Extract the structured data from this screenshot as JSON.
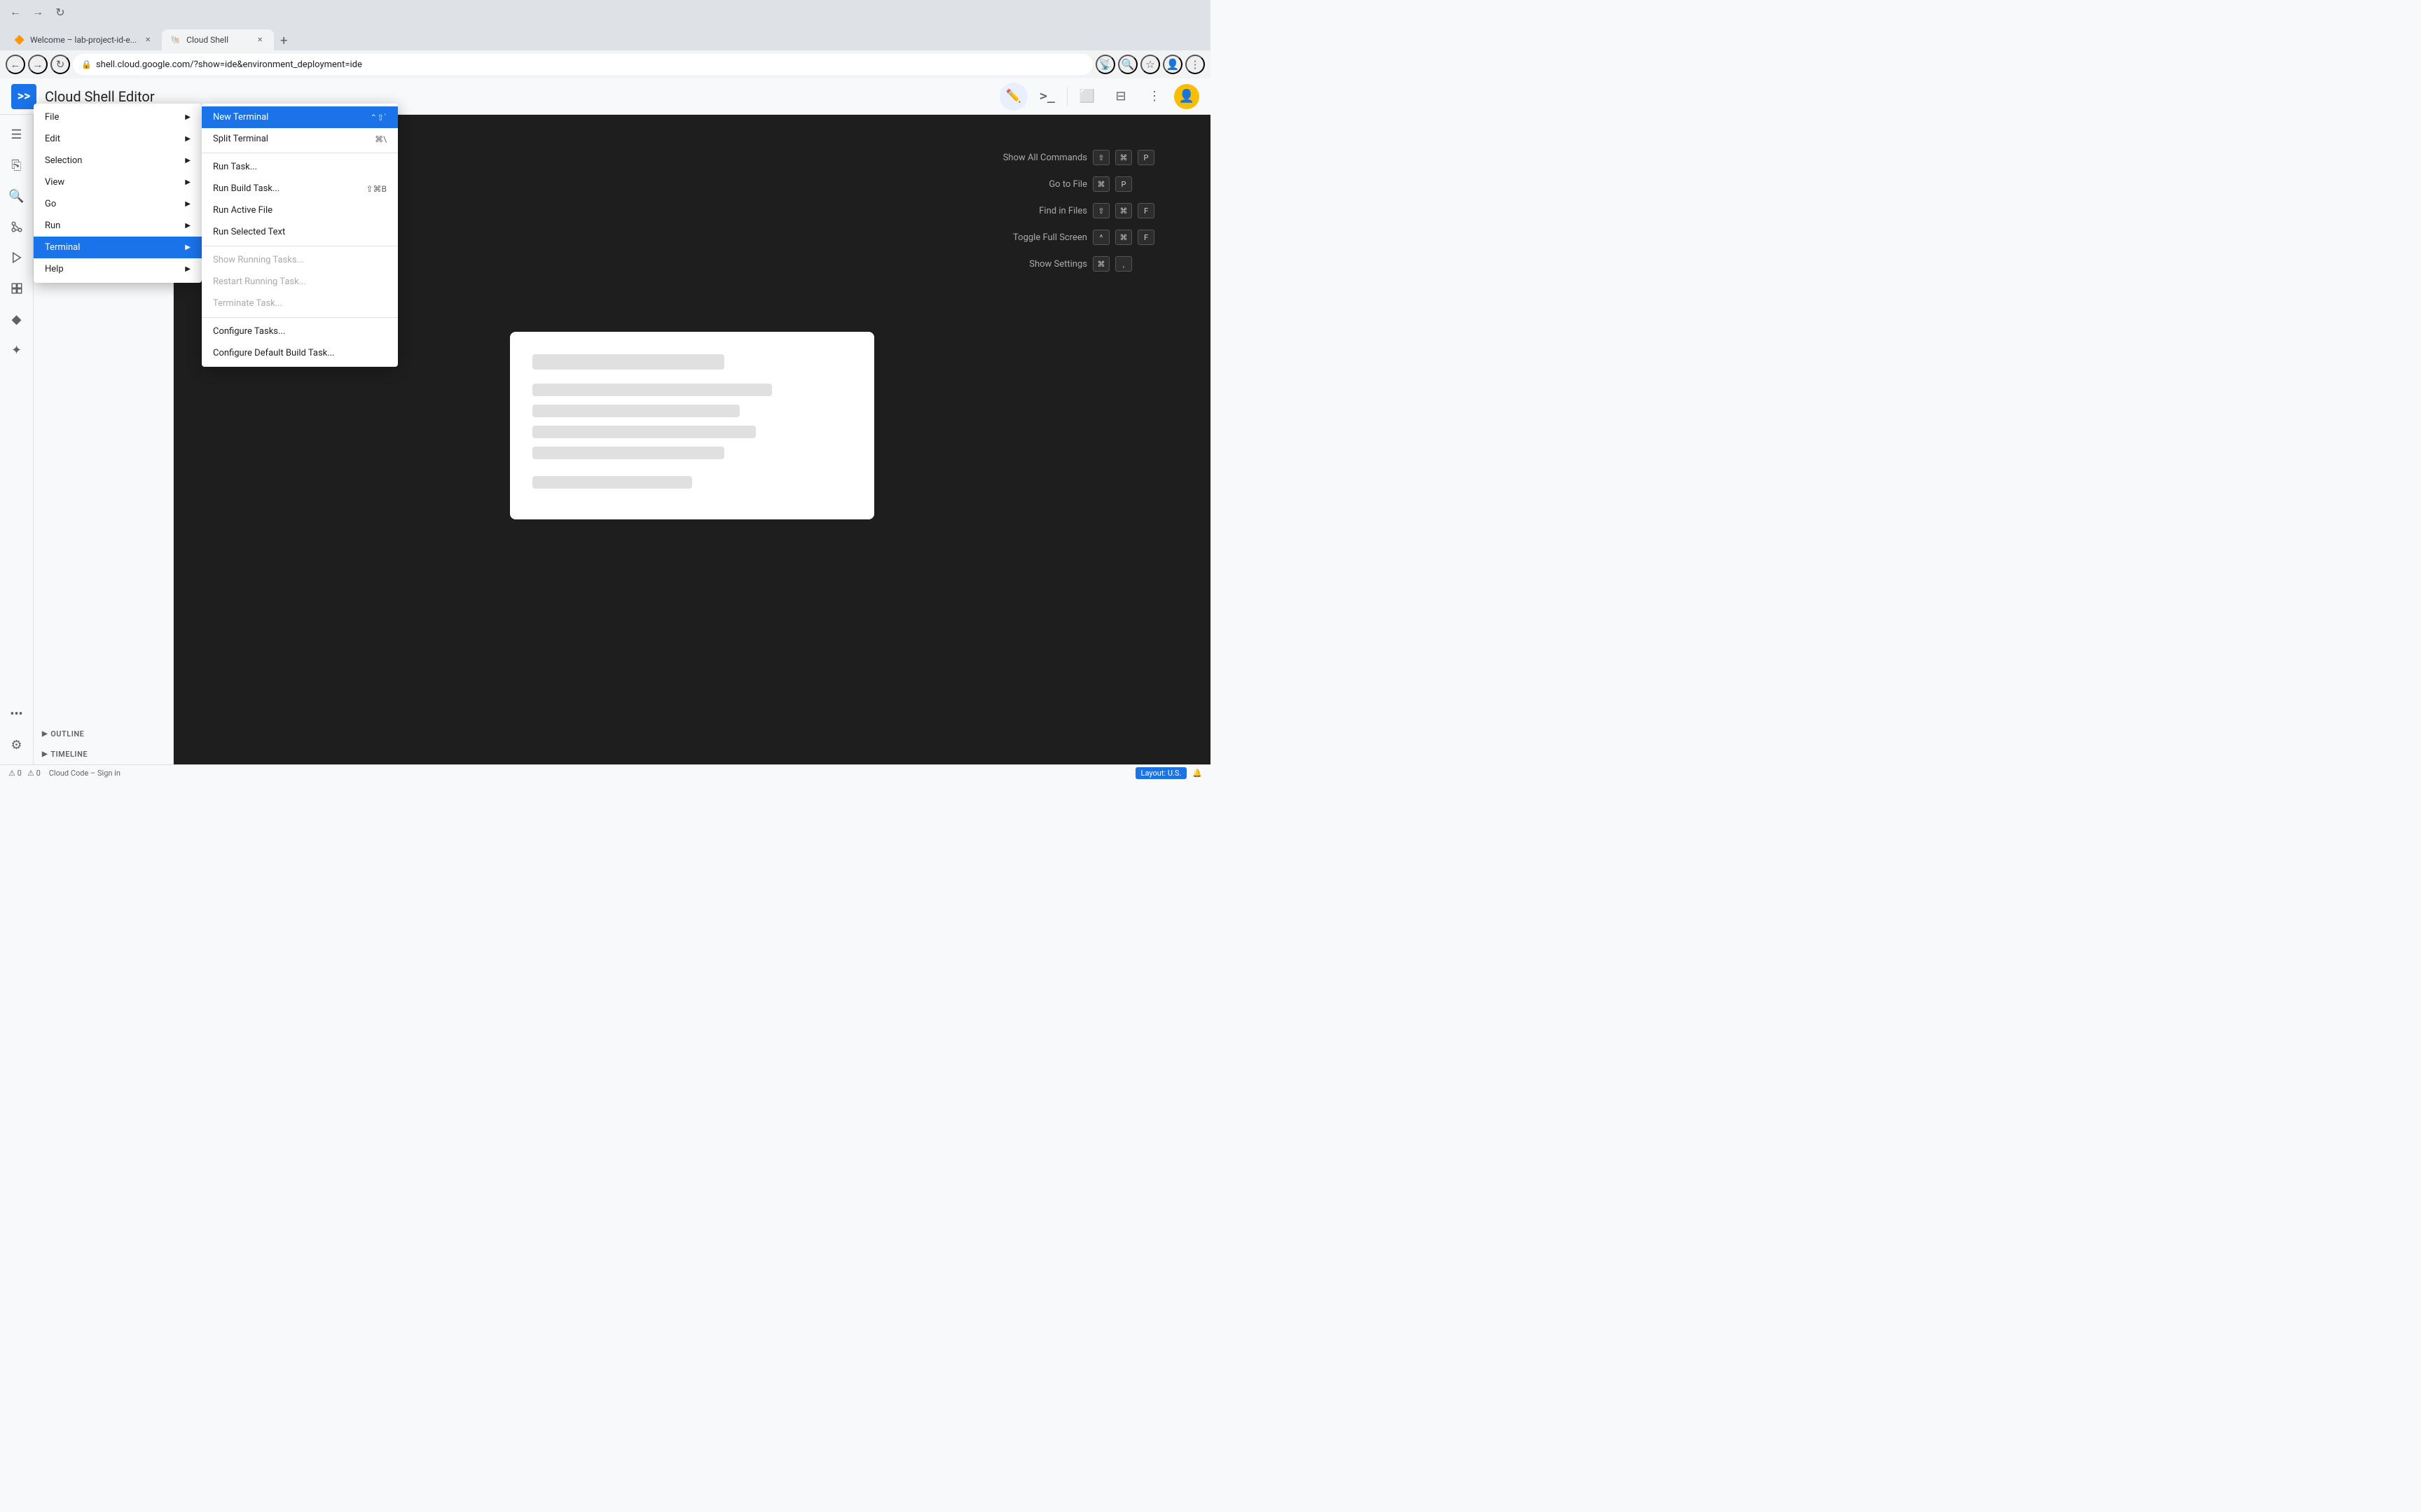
{
  "browser": {
    "tabs": [
      {
        "id": "tab1",
        "label": "Welcome – lab-project-id-e...",
        "favicon": "🔶",
        "active": false
      },
      {
        "id": "tab2",
        "label": "Cloud Shell",
        "favicon": "🐚",
        "active": true
      }
    ],
    "url": "shell.cloud.google.com/?show=ide&environment_deployment=ide",
    "new_tab_label": "+"
  },
  "header": {
    "logo_symbol": "≫",
    "title": "Cloud Shell Editor",
    "edit_icon": "✏️",
    "terminal_icon": ">_",
    "preview_icon": "⬜",
    "split_icon": "⬜",
    "more_icon": "⋮"
  },
  "sidebar": {
    "icons": [
      {
        "name": "menu",
        "symbol": "☰"
      },
      {
        "name": "explorer",
        "symbol": "⎘"
      },
      {
        "name": "search",
        "symbol": "🔍"
      },
      {
        "name": "git",
        "symbol": "⎇"
      },
      {
        "name": "run",
        "symbol": "▶"
      },
      {
        "name": "extensions",
        "symbol": "⊞"
      },
      {
        "name": "gem",
        "symbol": "◆"
      },
      {
        "name": "star",
        "symbol": "✦"
      },
      {
        "name": "more",
        "symbol": "•••"
      },
      {
        "name": "settings",
        "symbol": "⚙"
      }
    ]
  },
  "main_menu": {
    "items": [
      {
        "id": "file",
        "label": "File",
        "has_submenu": true
      },
      {
        "id": "edit",
        "label": "Edit",
        "has_submenu": true
      },
      {
        "id": "selection",
        "label": "Selection",
        "has_submenu": true
      },
      {
        "id": "view",
        "label": "View",
        "has_submenu": true
      },
      {
        "id": "go",
        "label": "Go",
        "has_submenu": true
      },
      {
        "id": "run",
        "label": "Run",
        "has_submenu": true
      },
      {
        "id": "terminal",
        "label": "Terminal",
        "has_submenu": true,
        "active": true
      },
      {
        "id": "help",
        "label": "Help",
        "has_submenu": true
      }
    ]
  },
  "terminal_menu": {
    "items": [
      {
        "id": "new_terminal",
        "label": "New Terminal",
        "shortcut": "⌃⇧`",
        "active": true,
        "disabled": false
      },
      {
        "id": "split_terminal",
        "label": "Split Terminal",
        "shortcut": "⌘\\",
        "active": false,
        "disabled": false
      },
      {
        "id": "divider1",
        "type": "divider"
      },
      {
        "id": "run_task",
        "label": "Run Task...",
        "shortcut": "",
        "active": false,
        "disabled": false
      },
      {
        "id": "run_build_task",
        "label": "Run Build Task...",
        "shortcut": "⇧⌘B",
        "active": false,
        "disabled": false
      },
      {
        "id": "run_active_file",
        "label": "Run Active File",
        "shortcut": "",
        "active": false,
        "disabled": false
      },
      {
        "id": "run_selected_text",
        "label": "Run Selected Text",
        "shortcut": "",
        "active": false,
        "disabled": false
      },
      {
        "id": "divider2",
        "type": "divider"
      },
      {
        "id": "show_running_tasks",
        "label": "Show Running Tasks...",
        "shortcut": "",
        "active": false,
        "disabled": true
      },
      {
        "id": "restart_running_task",
        "label": "Restart Running Task...",
        "shortcut": "",
        "active": false,
        "disabled": true
      },
      {
        "id": "terminate_task",
        "label": "Terminate Task...",
        "shortcut": "",
        "active": false,
        "disabled": true
      },
      {
        "id": "divider3",
        "type": "divider"
      },
      {
        "id": "configure_tasks",
        "label": "Configure Tasks...",
        "shortcut": "",
        "active": false,
        "disabled": false
      },
      {
        "id": "configure_default_build",
        "label": "Configure Default Build Task...",
        "shortcut": "",
        "active": false,
        "disabled": false
      }
    ]
  },
  "shortcuts": [
    {
      "label": "Show All Commands",
      "keys": [
        "⇧",
        "⌘",
        "P"
      ]
    },
    {
      "label": "Go to File",
      "keys": [
        "⌘",
        "P"
      ]
    },
    {
      "label": "Find in Files",
      "keys": [
        "⇧",
        "⌘",
        "F"
      ]
    },
    {
      "label": "Toggle Full Screen",
      "keys": [
        "^",
        "⌘",
        "F"
      ]
    },
    {
      "label": "Show Settings",
      "keys": [
        "⌘",
        ","
      ]
    }
  ],
  "outline": {
    "label": "OUTLINE"
  },
  "timeline": {
    "label": "TIMELINE"
  },
  "status_bar": {
    "errors": "0",
    "warnings": "0",
    "cloud_code": "Cloud Code – Sign in",
    "layout": "Layout: U.S.",
    "bell_icon": "🔔"
  }
}
